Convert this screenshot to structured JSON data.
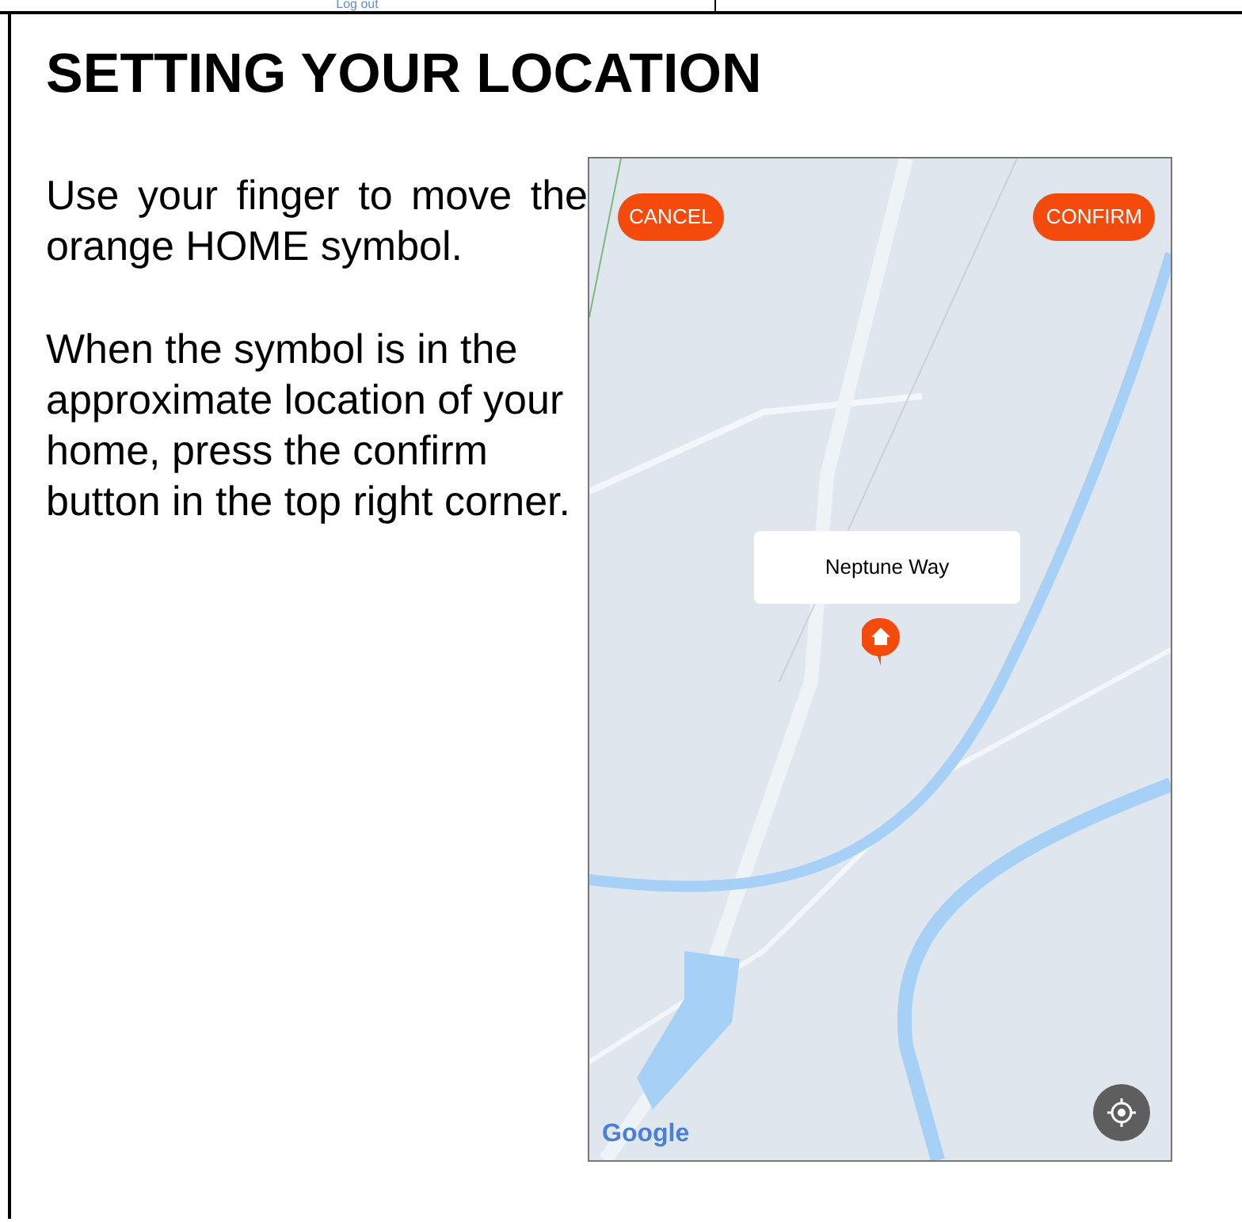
{
  "top_link": "Log out",
  "title": "SETTING YOUR LOCATION",
  "paragraphs": [
    {
      "text": "Use your finger to move the orange HOME symbol.",
      "kind": "justified"
    },
    {
      "text": "When the symbol is in the approximate location of your home, press the confirm button in the top right corner.",
      "kind": "ragged"
    }
  ],
  "screenshot": {
    "cancel_button": "CANCEL",
    "confirm_button": "CONFIRM",
    "popup": "Neptune Way",
    "map_logo": "Google"
  }
}
